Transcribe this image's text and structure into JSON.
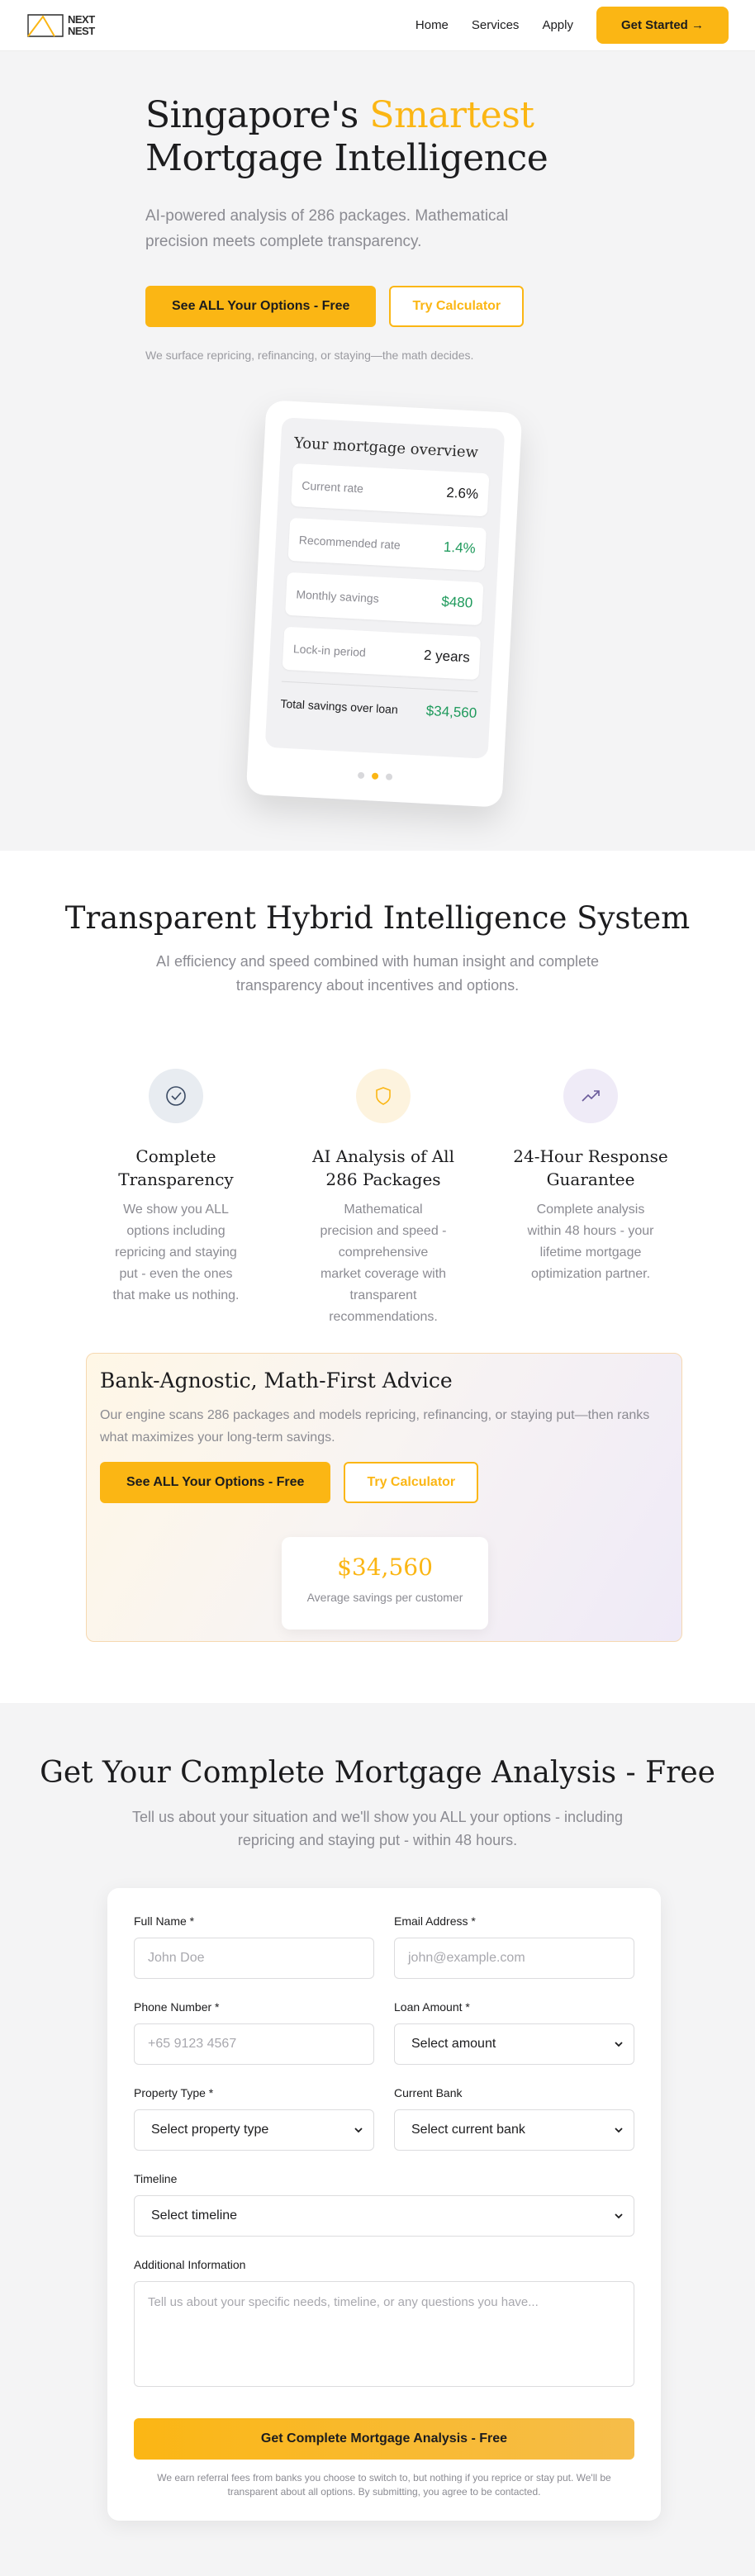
{
  "nav": {
    "logo_line1": "NEXT",
    "logo_line2": "NEST",
    "links": [
      "Home",
      "Services",
      "Apply"
    ],
    "cta": "Get Started →"
  },
  "hero": {
    "title_part1": "Singapore's ",
    "title_accent": "Smartest",
    "title_part2": "Mortgage Intelligence",
    "subtitle": "AI-powered analysis of 286 packages. Mathematical precision meets complete transparency.",
    "primary_btn": "See ALL Your Options - Free",
    "secondary_btn": "Try Calculator",
    "fine_print": "We surface repricing, refinancing, or staying—the math decides.",
    "overview": {
      "title": "Your mortgage overview",
      "rows": [
        {
          "label": "Current rate",
          "value": "2.6%"
        },
        {
          "label": "Recommended rate",
          "value": "1.4%"
        },
        {
          "label": "Monthly savings",
          "value": "$480"
        },
        {
          "label": "Lock-in period",
          "value": "2 years"
        }
      ],
      "total_label": "Total savings over loan",
      "total_value": "$34,560"
    }
  },
  "system": {
    "title": "Transparent Hybrid Intelligence System",
    "lead": "AI efficiency and speed combined with human insight and complete transparency about incentives and options.",
    "features": [
      {
        "title": "Complete Transparency",
        "text": "We show you ALL options including repricing and staying put - even the ones that make us nothing."
      },
      {
        "title": "AI Analysis of All 286 Packages",
        "text": "Mathematical precision and speed - comprehensive market coverage with transparent recommendations."
      },
      {
        "title": "24-Hour Response Guarantee",
        "text": "Complete analysis within 48 hours - your lifetime mortgage optimization partner."
      }
    ],
    "bank": {
      "title": "Bank-Agnostic, Math-First Advice",
      "text": "Our engine scans 286 packages and models repricing, refinancing, or staying put—then ranks what maximizes your long-term savings.",
      "primary_btn": "See ALL Your Options - Free",
      "secondary_btn": "Try Calculator",
      "savings_amount": "$34,560",
      "savings_label": "Average savings per customer"
    }
  },
  "form": {
    "title": "Get Your Complete Mortgage Analysis - Free",
    "lead": "Tell us about your situation and we'll show you ALL your options - including repricing and staying put - within 48 hours.",
    "full_name_label": "Full Name *",
    "full_name_placeholder": "John Doe",
    "email_label": "Email Address *",
    "email_placeholder": "john@example.com",
    "phone_label": "Phone Number *",
    "phone_placeholder": "+65 9123 4567",
    "loan_label": "Loan Amount *",
    "loan_value": "Select amount",
    "property_label": "Property Type *",
    "property_value": "Select property type",
    "bank_label": "Current Bank",
    "bank_value": "Select current bank",
    "timeline_label": "Timeline",
    "timeline_value": "Select timeline",
    "info_label": "Additional Information",
    "info_placeholder": "Tell us about your specific needs, timeline, or any questions you have...",
    "submit": "Get Complete Mortgage Analysis - Free",
    "disclaimer": "We earn referral fees from banks you choose to switch to, but nothing if you reprice or stay put. We'll be transparent about all options. By submitting, you agree to be contacted."
  },
  "colors": {
    "accent": "#fbb614",
    "green": "#1f9a5c",
    "muted": "#8b8b92"
  }
}
